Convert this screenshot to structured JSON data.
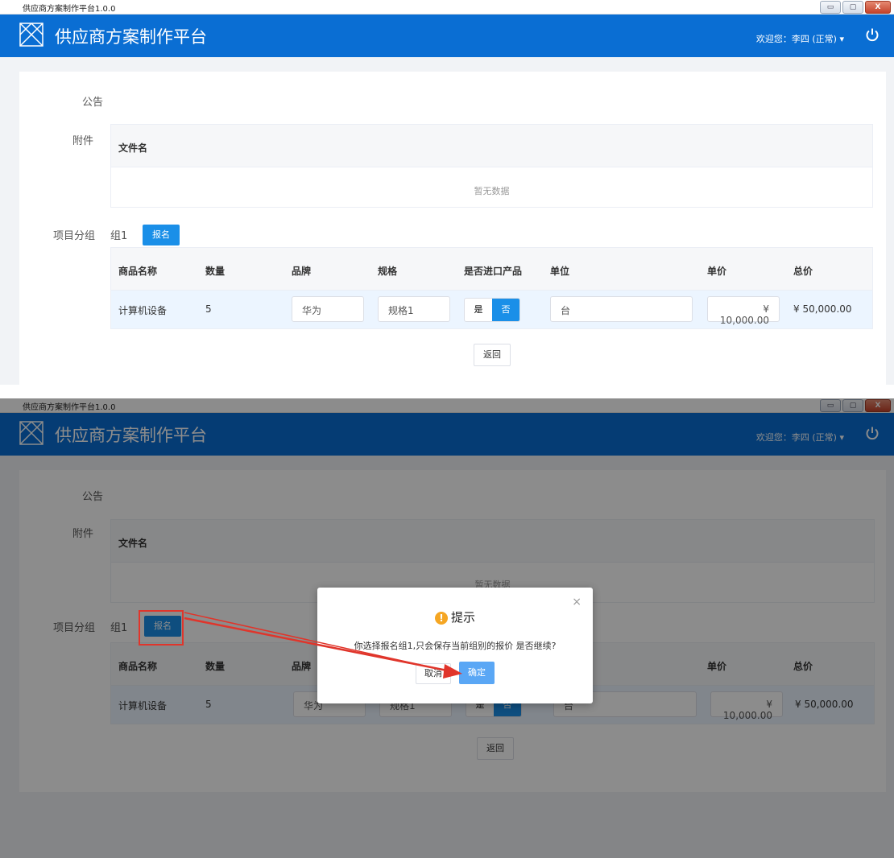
{
  "window": {
    "title": "供应商方案制作平台1.0.0",
    "controls": [
      "▭",
      "▢",
      "X"
    ]
  },
  "header": {
    "app_title": "供应商方案制作平台",
    "user_label": "欢迎您：李四 (正常) ▾"
  },
  "form": {
    "notice_label": "公告",
    "attachment_label": "附件",
    "attachment_table": {
      "columns": [
        "文件名"
      ],
      "empty_text": "暂无数据"
    },
    "group_label": "项目分组",
    "group_name": "组1",
    "signup_button": "报名",
    "product_table": {
      "columns": [
        "商品名称",
        "数量",
        "品牌",
        "规格",
        "是否进口产品",
        "单位",
        "单价",
        "总价"
      ],
      "rows": [
        {
          "name": "计算机设备",
          "qty": "5",
          "brand": "华为",
          "spec": "规格1",
          "import_options": [
            "是",
            "否"
          ],
          "import_selected": "否",
          "unit": "台",
          "unit_price": "¥ 10,000.00",
          "total": "¥ 50,000.00"
        }
      ]
    },
    "back_button": "返回"
  },
  "dialog": {
    "title": "提示",
    "message": "你选择报名组1,只会保存当前组别的报价 是否继续?",
    "cancel": "取消",
    "confirm": "确定",
    "close": "×"
  },
  "colors": {
    "header_blue": "#0a6ed3",
    "primary": "#1a8fe8",
    "annotation_red": "#e0352b",
    "warning": "#f5a623"
  }
}
